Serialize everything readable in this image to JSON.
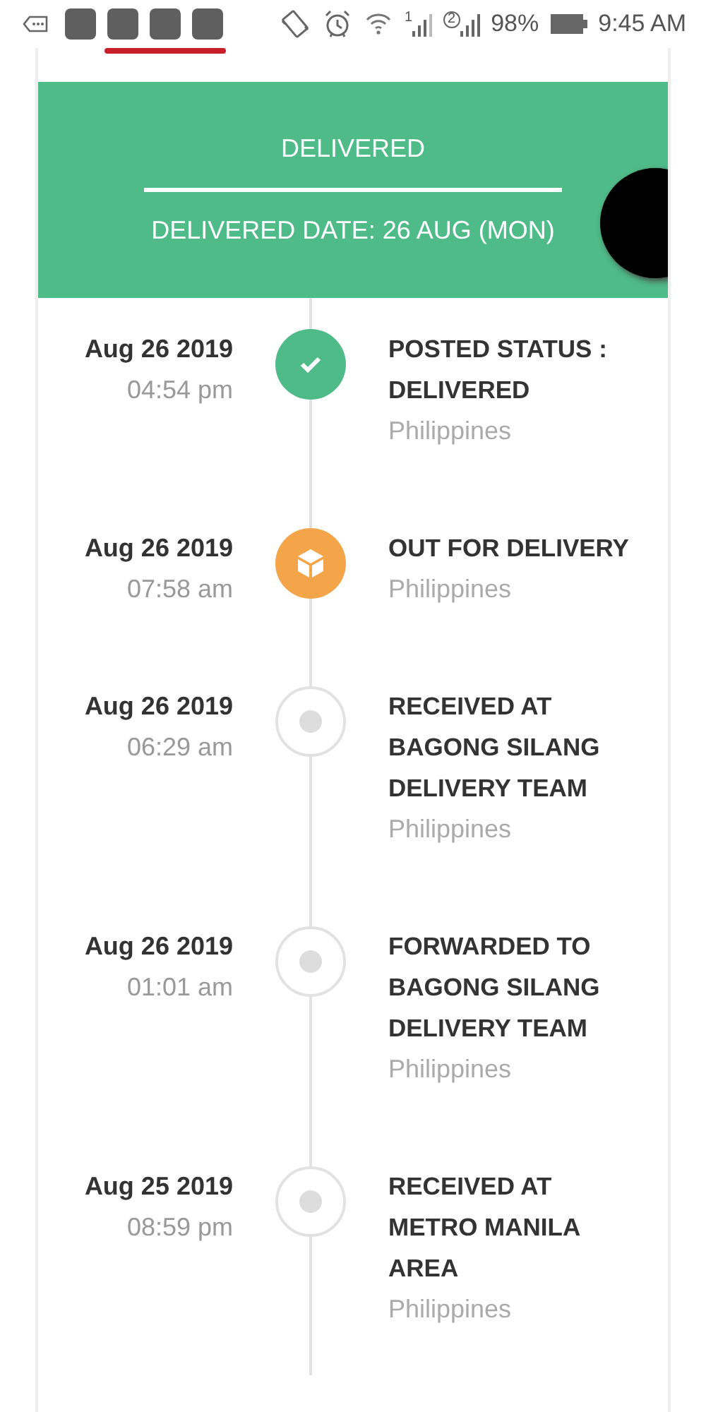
{
  "status_bar": {
    "sim_slots": [
      "1",
      "2"
    ],
    "battery": "98%",
    "time": "9:45 AM"
  },
  "header": {
    "status": "DELIVERED",
    "delivered_date": "DELIVERED DATE: 26 AUG (MON)"
  },
  "timeline": [
    {
      "date": "Aug 26 2019",
      "time": "04:54 pm",
      "title": "POSTED STATUS : DELIVERED",
      "location": "Philippines",
      "kind": "done"
    },
    {
      "date": "Aug 26 2019",
      "time": "07:58 am",
      "title": "OUT FOR DELIVERY",
      "location": "Philippines",
      "kind": "transit"
    },
    {
      "date": "Aug 26 2019",
      "time": "06:29 am",
      "title": "RECEIVED AT BAGONG SILANG DELIVERY TEAM",
      "location": "Philippines",
      "kind": "pending"
    },
    {
      "date": "Aug 26 2019",
      "time": "01:01 am",
      "title": "FORWARDED TO BAGONG SILANG DELIVERY TEAM",
      "location": "Philippines",
      "kind": "pending"
    },
    {
      "date": "Aug 25 2019",
      "time": "08:59 pm",
      "title": "RECEIVED AT METRO MANILA AREA",
      "location": "Philippines",
      "kind": "pending"
    }
  ]
}
